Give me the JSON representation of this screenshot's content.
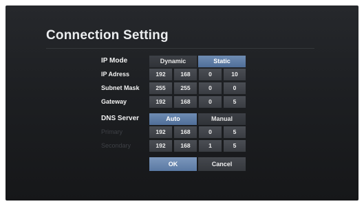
{
  "title": "Connection Setting",
  "ip_mode": {
    "label": "IP Mode",
    "options": [
      "Dynamic",
      "Static"
    ],
    "selected": "Static"
  },
  "ip_address": {
    "label": "IP Adress",
    "octets": [
      "192",
      "168",
      "0",
      "10"
    ]
  },
  "subnet_mask": {
    "label": "Subnet Mask",
    "octets": [
      "255",
      "255",
      "0",
      "0"
    ]
  },
  "gateway": {
    "label": "Gateway",
    "octets": [
      "192",
      "168",
      "0",
      "5"
    ]
  },
  "dns_server": {
    "label": "DNS Server",
    "options": [
      "Auto",
      "Manual"
    ],
    "selected": "Auto"
  },
  "primary": {
    "label": "Primary",
    "octets": [
      "192",
      "168",
      "0",
      "5"
    ]
  },
  "secondary": {
    "label": "Secondary",
    "octets": [
      "192",
      "168",
      "1",
      "5"
    ]
  },
  "buttons": {
    "ok": "OK",
    "cancel": "Cancel"
  },
  "colors": {
    "selected": "#5a79a3",
    "panel": "#1d1f22",
    "field": "#3f4247"
  }
}
